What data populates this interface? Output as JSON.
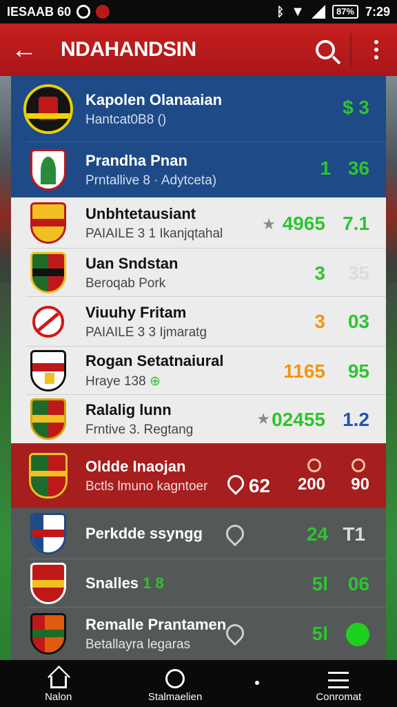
{
  "status_bar": {
    "time_left": "IESAAB 60",
    "battery": "87%",
    "time": "7:29"
  },
  "app_bar": {
    "title": "NDAHANDSIN"
  },
  "rows": [
    {
      "name": "Kapolen Olanaaian",
      "sub": "Hantcat0B8 ()",
      "stat1": "$ 3",
      "theme": "blue"
    },
    {
      "name": "Prandha Pnan",
      "sub": "Prntallive 8 · Adytceta)",
      "stat1": "1",
      "stat2": "36",
      "theme": "blue"
    },
    {
      "name": "Unbhtetausiant",
      "sub": "PAIAILE 3 1 Ikanjqtahal",
      "stat1": "4965",
      "stat2": "7.1",
      "theme": "white"
    },
    {
      "name": "Uan Sndstan",
      "sub": "Beroqab Pork",
      "stat1": "3",
      "stat2": "35",
      "theme": "white"
    },
    {
      "name": "Viuuhy Fritam",
      "sub": "PAIAILE 3 3 Ijmaratg",
      "stat1": "3",
      "stat2": "03",
      "theme": "white"
    },
    {
      "name": "Rogan Setatnaiural",
      "sub": "Hraye 138",
      "stat1": "1165",
      "stat2": "95",
      "theme": "white"
    },
    {
      "name": "Ralalig lunn",
      "sub": "Frntive 3. Regtang",
      "stat1": "02455",
      "stat2": "1.2",
      "theme": "white"
    },
    {
      "name": "Oldde Inaojan",
      "sub": "Bctls lmuno kagntoer",
      "stat1": "62",
      "stat2": "200",
      "stat3": "90",
      "theme": "red"
    },
    {
      "name": "Perkdde ssyngg",
      "sub": "",
      "stat1": "24",
      "stat2": "T1",
      "theme": "grey"
    },
    {
      "name": "Snalles",
      "name_extra": "1 8",
      "sub": "",
      "stat1": "5l",
      "stat2": "06",
      "theme": "grey"
    },
    {
      "name": "Remalle Prantamen",
      "sub": "Betallayra legaras",
      "stat1": "5l",
      "theme": "grey"
    }
  ],
  "bottom_nav": {
    "home": "Nalon",
    "stat": "Stalmaelien",
    "comment": "Conromat"
  },
  "colors": {
    "brand_red": "#c7201e",
    "blue_row": "#1e4a87",
    "stat_green": "#2ec52e",
    "stat_orange": "#f0960e"
  }
}
